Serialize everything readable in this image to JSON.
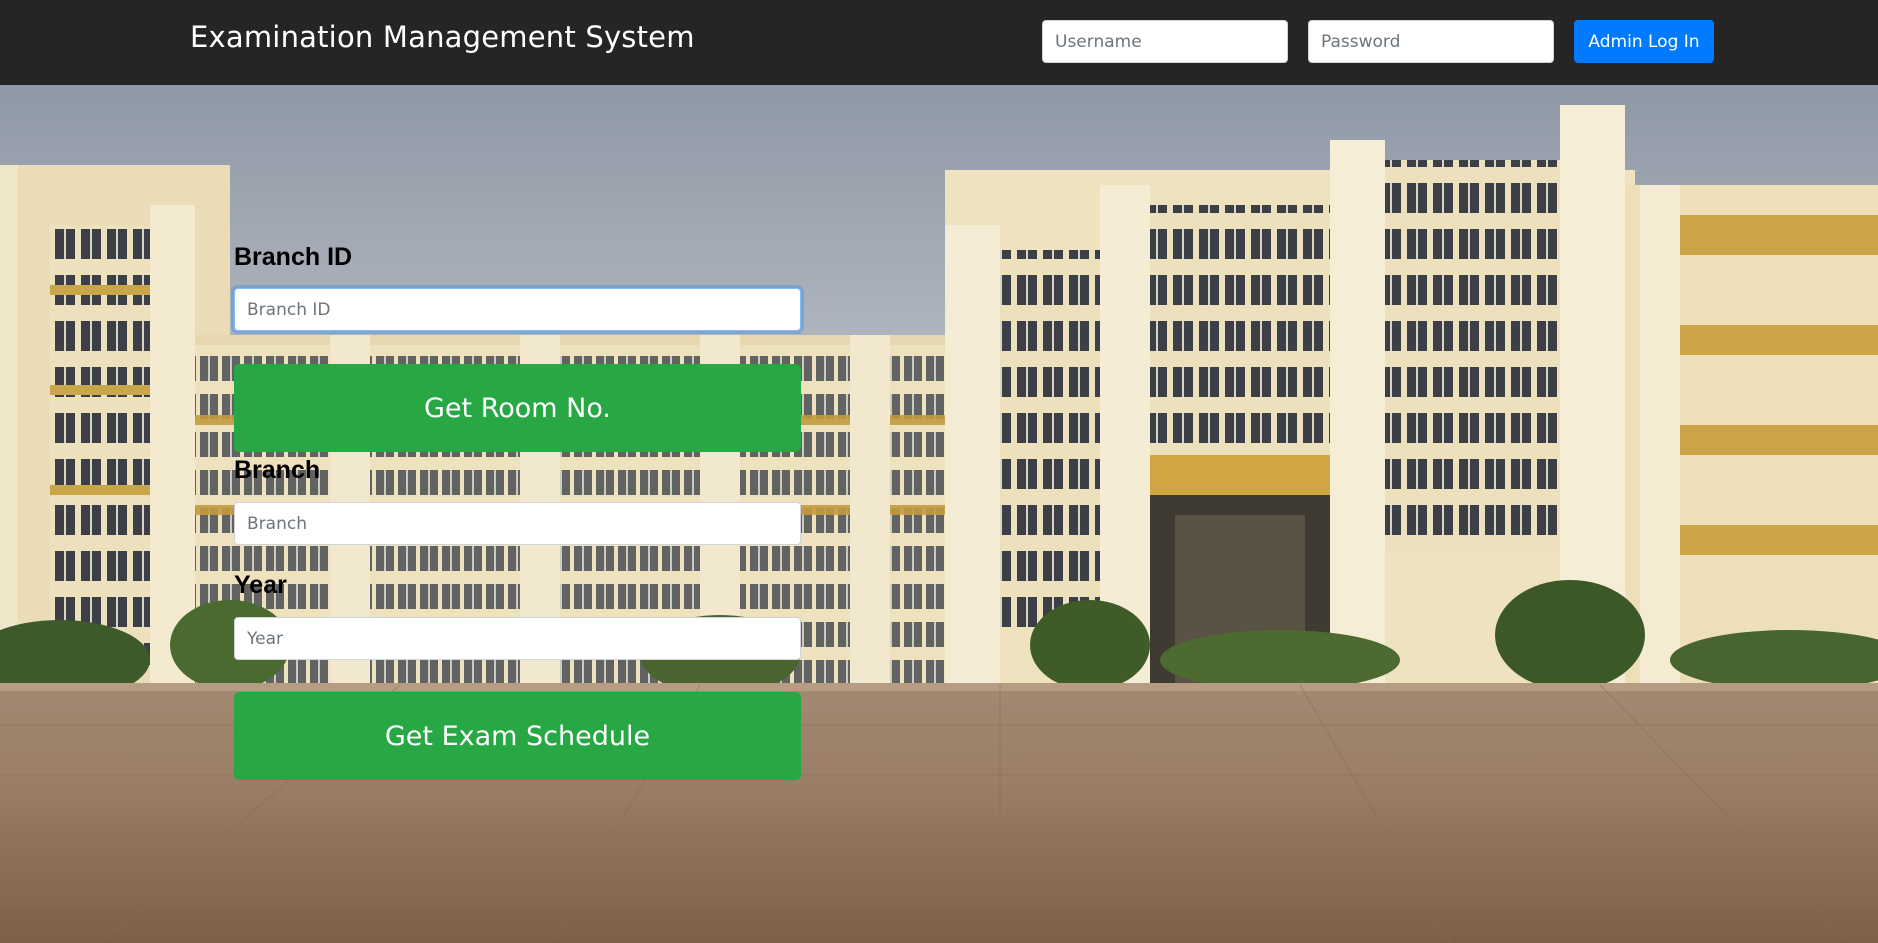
{
  "navbar": {
    "brand": "Examination Management System",
    "username_placeholder": "Username",
    "password_placeholder": "Password",
    "login_label": "Admin Log In"
  },
  "form": {
    "branch_id_label": "Branch ID",
    "branch_id_placeholder": "Branch ID",
    "room_button": "Get Room No.",
    "branch_label": "Branch",
    "branch_placeholder": "Branch",
    "year_label": "Year",
    "year_placeholder": "Year",
    "schedule_button": "Get Exam Schedule"
  },
  "colors": {
    "navbar_bg": "#252525",
    "primary": "#007bff",
    "success": "#28a745"
  }
}
